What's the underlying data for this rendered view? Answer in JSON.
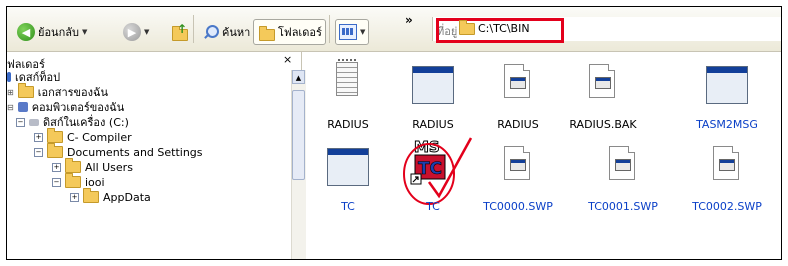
{
  "toolbar": {
    "back_label": "ย้อนกลับ",
    "search_label": "ค้นหา",
    "folders_label": "โฟลเดอร์",
    "overflow_label": "»"
  },
  "address": {
    "label": "ที่อยู่",
    "value": "C:\\TC\\BIN"
  },
  "left_pane": {
    "title": "ฟลเดอร์",
    "close": "×",
    "tree": [
      {
        "label": "เดสก์ท็อป"
      },
      {
        "label": "เอกสารของฉัน"
      },
      {
        "label": "คอมพิวเตอร์ของฉัน"
      },
      {
        "label": "ดิสก์ในเครื่อง (C:)"
      },
      {
        "label": "C- Compiler"
      },
      {
        "label": "Documents and Settings"
      },
      {
        "label": "All Users"
      },
      {
        "label": "iooi"
      },
      {
        "label": "AppData"
      }
    ]
  },
  "files": [
    {
      "name": "RADIUS",
      "type": "notes",
      "style": "black"
    },
    {
      "name": "RADIUS",
      "type": "window",
      "style": "black"
    },
    {
      "name": "RADIUS",
      "type": "doc",
      "style": "black"
    },
    {
      "name": "RADIUS.BAK",
      "type": "doc",
      "style": "black"
    },
    {
      "name": "TASM2MSG",
      "type": "window",
      "style": "blue"
    },
    {
      "name": "TC",
      "type": "window",
      "style": "blue"
    },
    {
      "name": "TC",
      "type": "ms-tc",
      "style": "blue"
    },
    {
      "name": "TC0000.SWP",
      "type": "doc",
      "style": "blue"
    },
    {
      "name": "TC0001.SWP",
      "type": "doc",
      "style": "blue"
    },
    {
      "name": "TC0002.SWP",
      "type": "doc",
      "style": "blue"
    }
  ],
  "icon_names": {
    "back": "back-arrow-icon",
    "forward": "forward-arrow-icon",
    "up": "folder-up-icon",
    "search": "search-icon",
    "folders": "folders-icon",
    "views": "views-icon"
  },
  "colors": {
    "highlight": "#e3001b",
    "link_blue": "#0a3fc7"
  }
}
